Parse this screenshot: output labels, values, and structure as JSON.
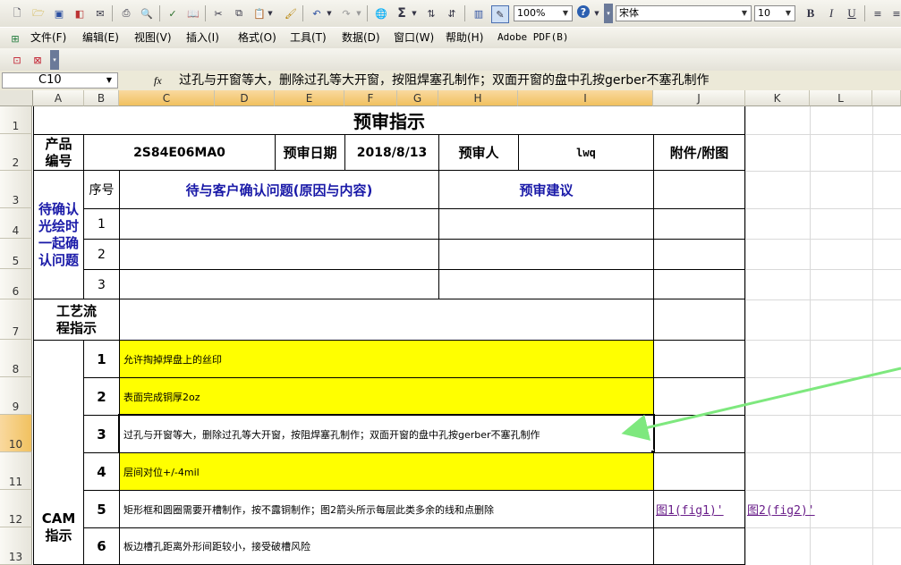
{
  "toolbar": {
    "zoom": "100%",
    "font_name": "宋体",
    "font_size": "10",
    "bold": "B",
    "italic": "I",
    "underline": "U",
    "sum": "Σ"
  },
  "menu": {
    "items": [
      "文件(F)",
      "编辑(E)",
      "视图(V)",
      "插入(I)",
      "格式(O)",
      "工具(T)",
      "数据(D)",
      "窗口(W)",
      "帮助(H)",
      "Adobe PDF(B)"
    ]
  },
  "formula_bar": {
    "name_box": "C10",
    "fx": "fx",
    "content": "过孔与开窗等大，删除过孔等大开窗，按阻焊塞孔制作；双面开窗的盘中孔按gerber不塞孔制作"
  },
  "columns": [
    "A",
    "B",
    "C",
    "D",
    "E",
    "F",
    "G",
    "H",
    "I",
    "J",
    "K",
    "L"
  ],
  "rows": [
    "1",
    "2",
    "3",
    "4",
    "5",
    "6",
    "7",
    "8",
    "9",
    "10",
    "11",
    "12",
    "13"
  ],
  "sheet": {
    "title": "预审指示",
    "product_no_label": "产品编号",
    "product_no": "2S84E06MA0",
    "review_date_label": "预审日期",
    "review_date": "2018/8/13",
    "reviewer_label": "预审人",
    "reviewer": "lwq",
    "attachment_label": "附件/附图",
    "confirm_section_label": "待确认光绘时一起确认问题",
    "seq_label": "序号",
    "question_header": "待与客户确认问题(原因与内容)",
    "suggestion_header": "预审建议",
    "question_rows": [
      "1",
      "2",
      "3"
    ],
    "process_label": "工艺流程指示",
    "cam_label": "CAM指示",
    "cam_items": [
      {
        "no": "1",
        "text": "允许掏掉焊盘上的丝印"
      },
      {
        "no": "2",
        "text": "表面完成铜厚2oz"
      },
      {
        "no": "3",
        "text": "过孔与开窗等大，删除过孔等大开窗，按阻焊塞孔制作；双面开窗的盘中孔按gerber不塞孔制作"
      },
      {
        "no": "4",
        "text": "层间对位+/-4mil"
      },
      {
        "no": "5",
        "text": "矩形框和圆圈需要开槽制作，按不露铜制作；图2箭头所示每层此类多余的线和点删除"
      },
      {
        "no": "6",
        "text": "板边槽孔距离外形间距较小，接受破槽风险"
      }
    ],
    "link_fig1": "图1(fig1)'",
    "link_fig2": "图2(fig2)'"
  },
  "colors": {
    "highlight": "#ffff00",
    "header_blue": "#1a1aa8",
    "arrow": "#7ee87e",
    "link": "#6a1f8a"
  }
}
